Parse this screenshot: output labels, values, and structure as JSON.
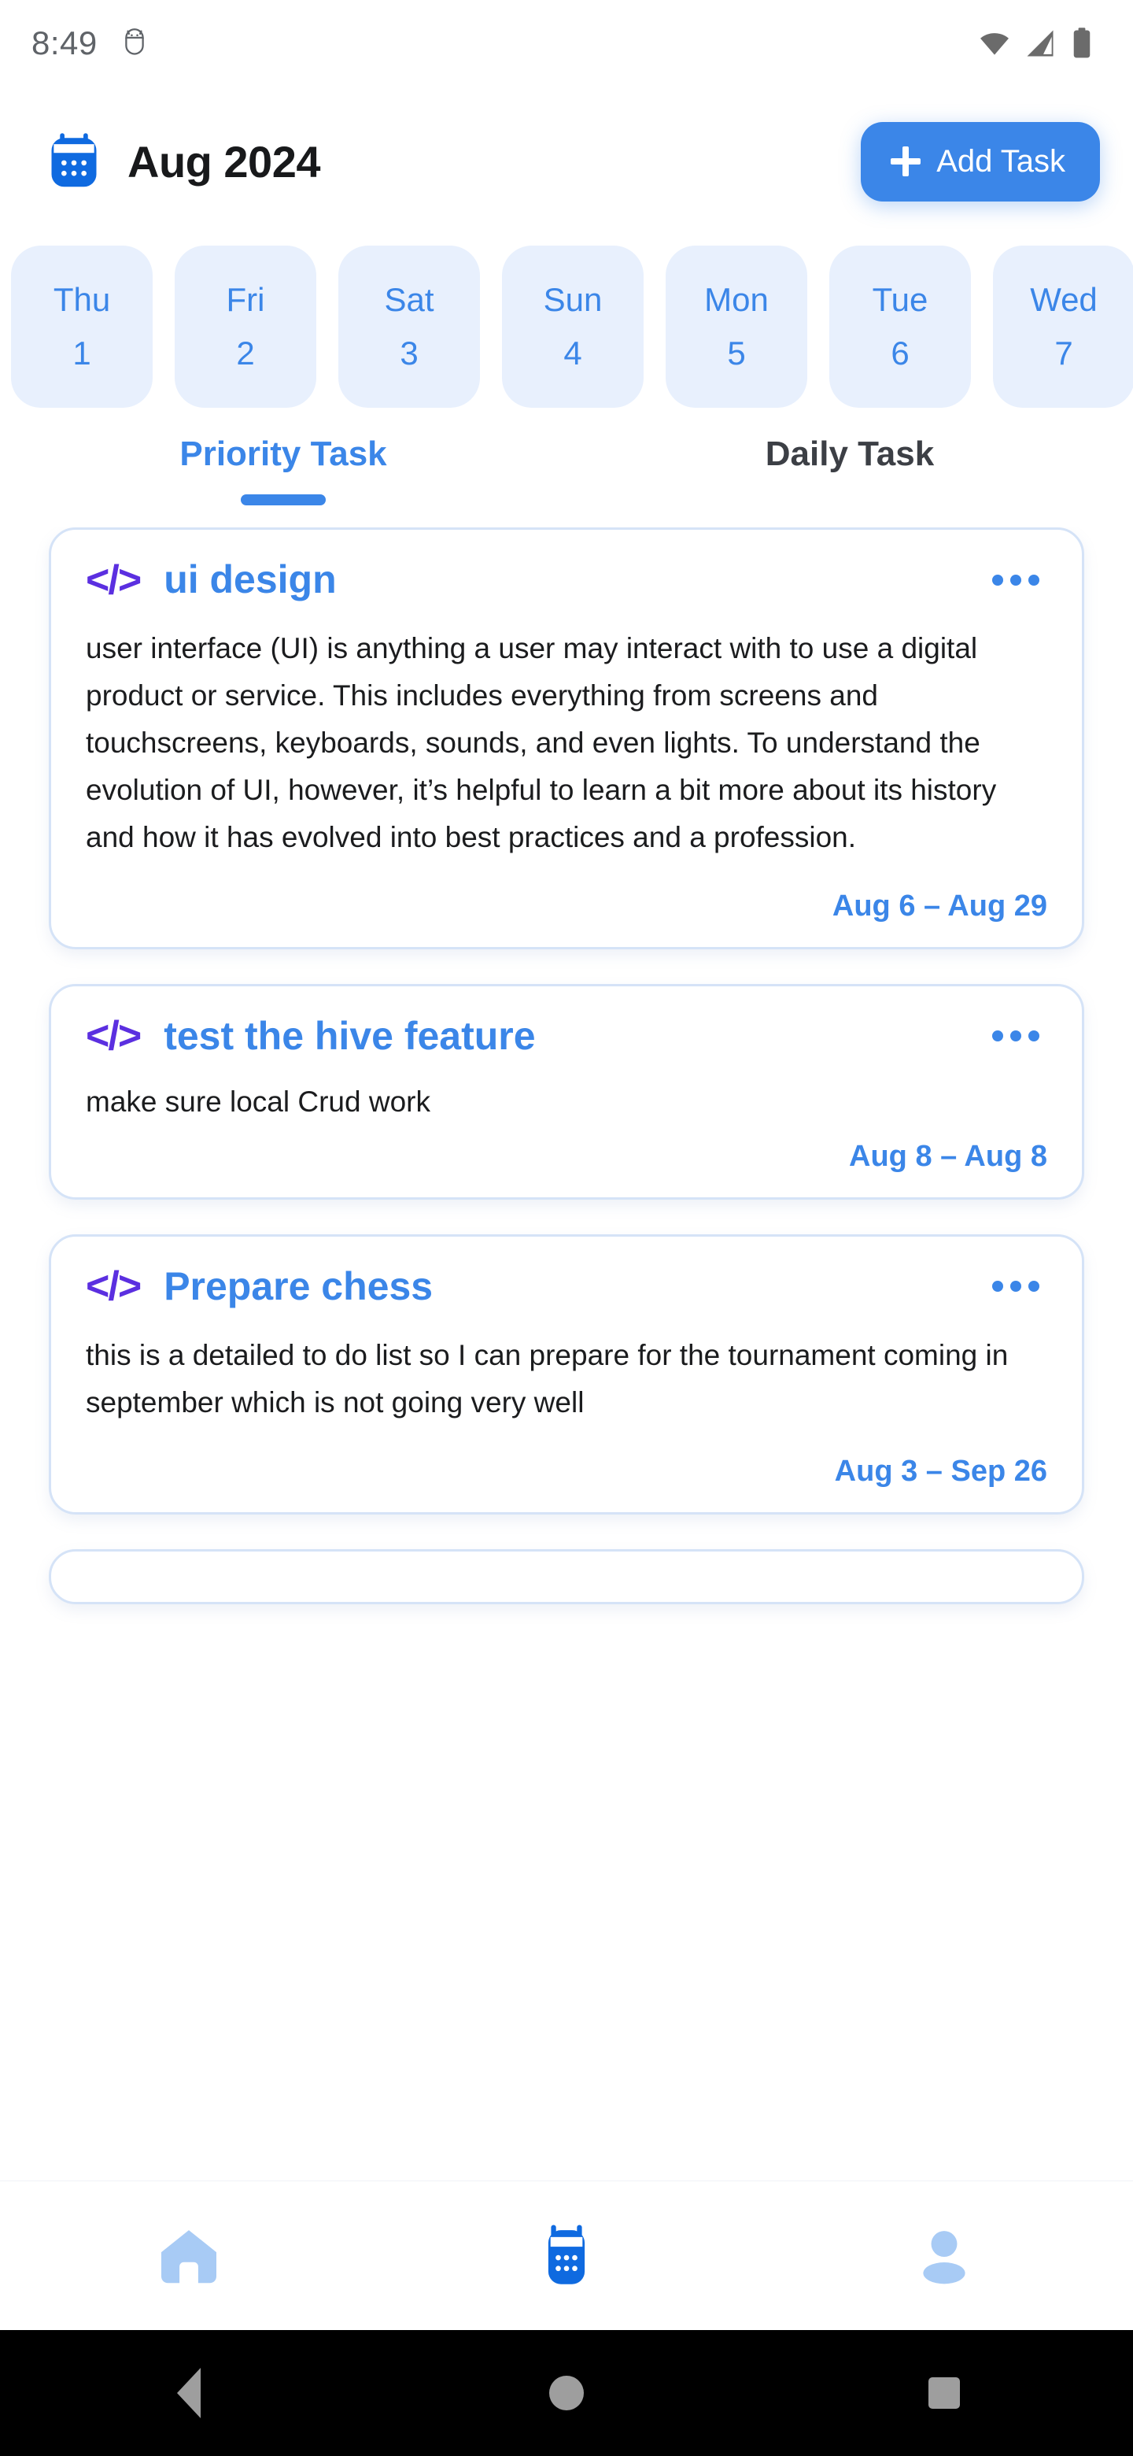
{
  "status_bar": {
    "time": "8:49",
    "icons": [
      "android-debug-icon",
      "wifi-icon",
      "cellular-signal-icon",
      "battery-icon"
    ]
  },
  "header": {
    "icon": "calendar-icon",
    "title": "Aug 2024",
    "add_task_label": "Add Task"
  },
  "date_strip": {
    "days": [
      {
        "dow": "Thu",
        "num": "1"
      },
      {
        "dow": "Fri",
        "num": "2"
      },
      {
        "dow": "Sat",
        "num": "3"
      },
      {
        "dow": "Sun",
        "num": "4"
      },
      {
        "dow": "Mon",
        "num": "5"
      },
      {
        "dow": "Tue",
        "num": "6"
      },
      {
        "dow": "Wed",
        "num": "7"
      }
    ]
  },
  "tabs": [
    {
      "label": "Priority Task",
      "active": true
    },
    {
      "label": "Daily Task",
      "active": false
    }
  ],
  "tasks": [
    {
      "icon": "code-icon",
      "title": "ui design",
      "description": "user interface (UI) is anything a user may interact with to use a digital product or service. This includes everything from screens and touchscreens, keyboards, sounds, and even lights. To understand the evolution of UI, however, it’s helpful to learn a bit more about its history and how it has evolved into best practices and a profession.",
      "range": "Aug 6 – Aug 29",
      "menu": "more-options-icon"
    },
    {
      "icon": "code-icon",
      "title": "test the hive feature",
      "description": "make sure local Crud work",
      "range": "Aug 8 – Aug 8",
      "menu": "more-options-icon"
    },
    {
      "icon": "code-icon",
      "title": "Prepare chess",
      "description": "this is a detailed to do list so I can prepare for the tournament  coming in september which is not going very well",
      "range": "Aug 3 – Sep 26",
      "menu": "more-options-icon"
    }
  ],
  "bottom_nav": [
    {
      "icon": "home-icon",
      "active": false
    },
    {
      "icon": "calendar-icon",
      "active": true
    },
    {
      "icon": "person-icon",
      "active": false
    }
  ],
  "android_nav": [
    {
      "icon": "back-icon"
    },
    {
      "icon": "home-circle-icon"
    },
    {
      "icon": "recents-icon"
    }
  ],
  "colors": {
    "accent": "#3b86e8",
    "accent_dark": "#0f6ae0",
    "accent_light": "#a8cbf5",
    "chip_bg": "#e8f0fd",
    "code_purple": "#5b2fe0",
    "card_border": "#d5e3f7",
    "text_dark": "#18191b",
    "tab_inactive": "#3c3f45"
  }
}
